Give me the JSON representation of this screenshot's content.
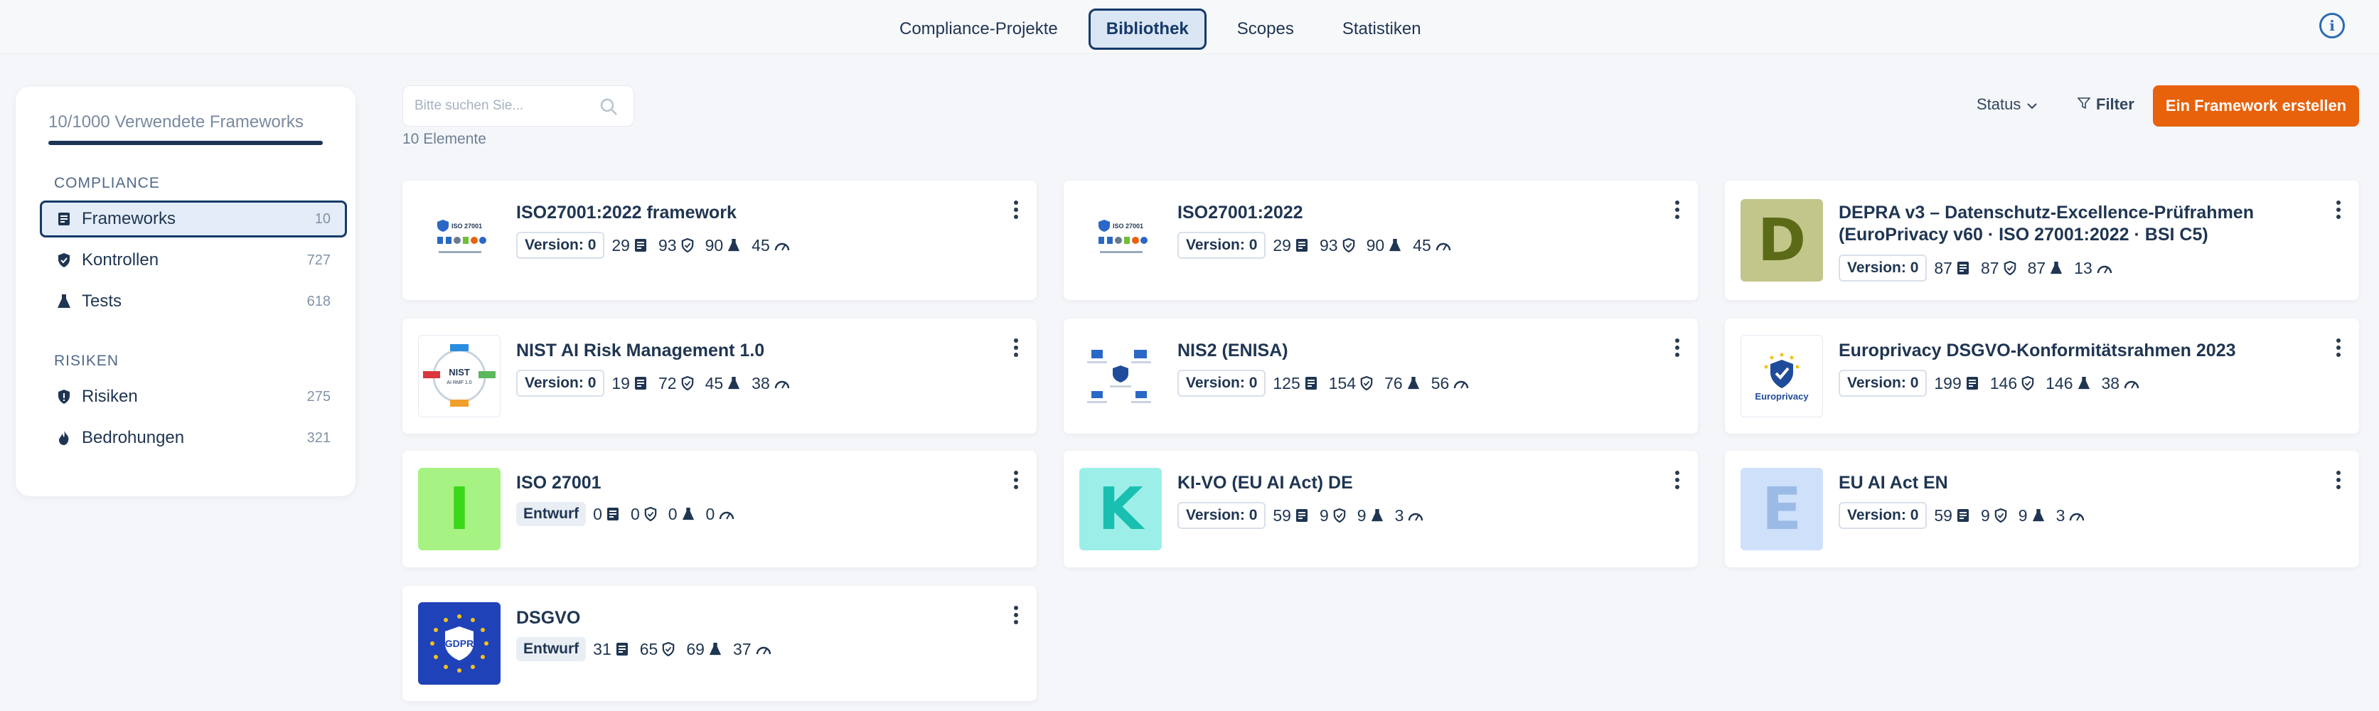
{
  "nav": {
    "tabs": [
      "Compliance-Projekte",
      "Bibliothek",
      "Scopes",
      "Statistiken"
    ],
    "active_tab": "Bibliothek",
    "info_icon": "info-icon"
  },
  "sidebar": {
    "usage_text": "10/1000 Verwendete Frameworks",
    "usage_fraction": 0.01,
    "sections": [
      {
        "title": "COMPLIANCE",
        "items": [
          {
            "label": "Frameworks",
            "count": "10",
            "icon": "framework-icon"
          },
          {
            "label": "Kontrollen",
            "count": "727",
            "icon": "shield-icon"
          },
          {
            "label": "Tests",
            "count": "618",
            "icon": "flask-icon"
          }
        ]
      },
      {
        "title": "RISIKEN",
        "items": [
          {
            "label": "Risiken",
            "count": "275",
            "icon": "shield-icon"
          },
          {
            "label": "Bedrohungen",
            "count": "321",
            "icon": "fire-icon"
          }
        ]
      }
    ]
  },
  "toolbar": {
    "search_placeholder": "Bitte suchen Sie...",
    "count_label": "10 Elemente",
    "status_label": "Status",
    "filter_label": "Filter",
    "create_label": "Ein Framework erstellen"
  },
  "cards": [
    {
      "title": "ISO27001:2022 framework",
      "badge": "Version: 0",
      "m": [
        "29",
        "93",
        "90",
        "45"
      ],
      "thumb": "iso"
    },
    {
      "title": "ISO27001:2022",
      "badge": "Version: 0",
      "m": [
        "29",
        "93",
        "90",
        "45"
      ],
      "thumb": "iso"
    },
    {
      "title": "DEPRA v3 – Datenschutz-Excellence-Prüfrahmen",
      "title2": "(EuroPrivacy v60 · ISO 27001:2022 · BSI C5)",
      "badge": "Version: 0",
      "m": [
        "87",
        "87",
        "87",
        "13"
      ],
      "thumb": "letter",
      "letter": "D",
      "bg": "#c2c68a",
      "fg": "#5b6a16"
    },
    {
      "title": "NIST AI Risk Management 1.0",
      "badge": "Version: 0",
      "m": [
        "19",
        "72",
        "45",
        "38"
      ],
      "thumb": "nist"
    },
    {
      "title": "NIS2 (ENISA)",
      "badge": "Version: 0",
      "m": [
        "125",
        "154",
        "76",
        "56"
      ],
      "thumb": "nis2"
    },
    {
      "title": "Europrivacy DSGVO-Konformitätsrahmen 2023",
      "badge": "Version: 0",
      "m": [
        "199",
        "146",
        "146",
        "38"
      ],
      "thumb": "europrivacy",
      "thumb_text": "Europrivacy"
    },
    {
      "title": "ISO 27001",
      "badge": "Entwurf",
      "m": [
        "0",
        "0",
        "0",
        "0"
      ],
      "thumb": "letter",
      "letter": "I",
      "bg": "#a6f283",
      "fg": "#3bd71a"
    },
    {
      "title": "KI-VO (EU AI Act) DE",
      "badge": "Version: 0",
      "m": [
        "59",
        "9",
        "9",
        "3"
      ],
      "thumb": "letter",
      "letter": "K",
      "bg": "#9cefe8",
      "fg": "#19bfb0"
    },
    {
      "title": "EU AI Act EN",
      "badge": "Version: 0",
      "m": [
        "59",
        "9",
        "9",
        "3"
      ],
      "thumb": "letter",
      "letter": "E",
      "bg": "#cfe0fa",
      "fg": "#9bbbe7"
    },
    {
      "title": "DSGVO",
      "badge": "Entwurf",
      "m": [
        "31",
        "65",
        "69",
        "37"
      ],
      "thumb": "gdpr",
      "thumb_text": "GDPR"
    }
  ],
  "colors": {
    "accent": "#e8610b",
    "primary": "#153a6a"
  }
}
